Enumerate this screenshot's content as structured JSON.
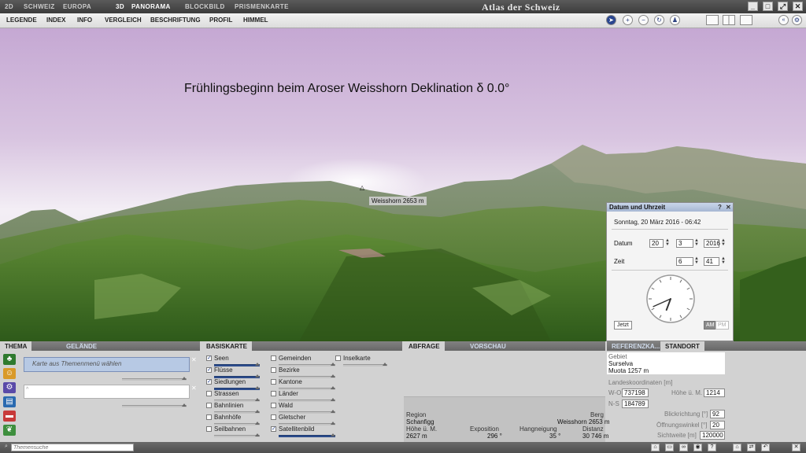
{
  "app": {
    "title": "Atlas der Schweiz",
    "mode_2d": "2D",
    "mode_3d": "3D",
    "nav_2d": [
      "SCHWEIZ",
      "EUROPA"
    ],
    "nav_3d": [
      "PANORAMA",
      "BLOCKBILD",
      "PRISMENKARTE"
    ],
    "window_buttons": [
      "_",
      "□",
      "⤢",
      "✕"
    ]
  },
  "menu": {
    "items": [
      "LEGENDE",
      "INDEX",
      "INFO",
      "VERGLEICH",
      "BESCHRIFTUNG",
      "PROFIL",
      "HIMMEL"
    ]
  },
  "toolbar": {
    "tools": [
      "arrow-pointer-icon",
      "zoom-in-icon",
      "zoom-out-icon",
      "rotate-icon",
      "walk-icon"
    ],
    "views": [
      "single-view-icon",
      "split-view-icon",
      "info-icon"
    ],
    "collapse_icon": "double-chevron-left-icon"
  },
  "scene": {
    "headline": "Frühlingsbeginn  beim Aroser Weisshorn Deklination δ 0.0°",
    "peak_label": "Weisshorn   2653 m",
    "peak_marker": "△",
    "colors": {
      "sky_top": "#c6a9d4",
      "sky_horizon": "#f5f1f6",
      "terrain": "#4f7a2e"
    }
  },
  "datetime": {
    "title": "Datum und Uhrzeit",
    "help": "?",
    "close": "✕",
    "current": "Sonntag, 20 März 2016 - 06:42",
    "date_label": "Datum",
    "day": "20",
    "month": "3",
    "year": "2016",
    "time_label": "Zeit",
    "hour": "6",
    "minute": "41",
    "clock_hour": 6,
    "clock_minute": 41,
    "now_button": "Jetzt",
    "am": "AM",
    "pm": "PM"
  },
  "thema": {
    "tabs": [
      "THEMA",
      "GELÄNDE"
    ],
    "placeholder": "Karte aus Themenmenü wählen",
    "icons": [
      "tree-icon",
      "people-icon",
      "gear-icon",
      "building-icon",
      "train-icon",
      "leaf-icon"
    ]
  },
  "basiskarte": {
    "tab": "BASISKARTE",
    "col1": [
      {
        "label": "Seen",
        "checked": true
      },
      {
        "label": "Flüsse",
        "checked": true
      },
      {
        "label": "Siedlungen",
        "checked": true
      },
      {
        "label": "Strassen",
        "checked": false
      },
      {
        "label": "Bahnlinien",
        "checked": false
      },
      {
        "label": "Bahnhöfe",
        "checked": false
      },
      {
        "label": "Seilbahnen",
        "checked": false
      }
    ],
    "col2": [
      {
        "label": "Gemeinden",
        "checked": false
      },
      {
        "label": "Bezirke",
        "checked": false
      },
      {
        "label": "Kantone",
        "checked": false
      },
      {
        "label": "Länder",
        "checked": false
      },
      {
        "label": "Wald",
        "checked": false
      },
      {
        "label": "Gletscher",
        "checked": false
      },
      {
        "label": "Satellitenbild",
        "checked": true
      }
    ],
    "col3": [
      {
        "label": "Inselkarte",
        "checked": false
      }
    ]
  },
  "abfrage": {
    "tabs": [
      "ABFRAGE",
      "VORSCHAU"
    ],
    "region_label": "Region",
    "region": "Schanfigg",
    "berg_label": "Berg",
    "berg": "Weisshorn   2653 m",
    "hoehe_label": "Höhe ü. M.",
    "hoehe": "2627 m",
    "exposition_label": "Exposition",
    "exposition": "296 °",
    "neigung_label": "Hangneigung",
    "neigung": "35 °",
    "distanz_label": "Distanz",
    "distanz": "30 746 m"
  },
  "standort": {
    "tabs": [
      "REFERENZKA...",
      "STANDORT"
    ],
    "gebiet_label": "Gebiet",
    "gebiet_lines": [
      "Surselva",
      "Muota   1257 m"
    ],
    "coords_label": "Landeskoordinaten [m]",
    "wo_label": "W-O",
    "wo": "737198",
    "ns_label": "N-S",
    "ns": "184789",
    "hoehe_label": "Höhe ü. M.",
    "hoehe": "1214",
    "blick_label": "Blickrichtung [°]",
    "blick": "92",
    "oeffnung_label": "Öffnungswinkel [°]",
    "oeffnung": "20",
    "sicht_label": "Sichtweite [m]",
    "sicht": "120000"
  },
  "status": {
    "search_placeholder": "Themensuche",
    "icons": [
      "home-icon",
      "print-icon",
      "link-icon",
      "camera-icon",
      "help-icon",
      "fullscreen-icon",
      "export-icon",
      "undo-icon",
      "close-icon"
    ]
  }
}
